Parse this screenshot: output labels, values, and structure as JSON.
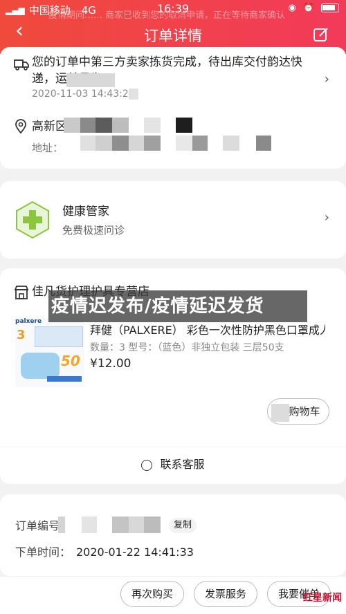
{
  "status_bar": {
    "carrier": "中国移动",
    "network": "4G",
    "time": "16:39"
  },
  "header": {
    "title": "订单详情",
    "notice": "疫情期间…… 商家已收到您的取消申请，正在等待商家确认"
  },
  "shipping": {
    "message": "您的订单中第三方卖家拣货完成，待出库交付韵达快递，运单号为",
    "timestamp": "2020-11-03 14:43:29",
    "address_name": "高新区",
    "address_label": "地址："
  },
  "health": {
    "title": "健康管家",
    "subtitle": "免费极速问诊"
  },
  "store": {
    "name": "佳凡货护理护具专营店",
    "product": {
      "brand_tag": "palxere",
      "name": "拜健（PALXERE） 彩色一次性防护黑色口罩成人...",
      "spec": "数量：3  型号：（蓝色）非独立包装 三层50支",
      "price": "¥12.00",
      "image_badge": "50",
      "image_count": "3"
    },
    "cart_button": "购物车",
    "service_button": "联系客服"
  },
  "overlay_caption": "疫情迟发布/疫情延迟发货",
  "order": {
    "number_label": "订单编号：",
    "copy_button": "复制",
    "time_label": "下单时间：",
    "time_value": "2020-01-22 14:41:33"
  },
  "actions": {
    "rebuy": "再次购买",
    "invoice": "发票服务",
    "urge": "我要催单"
  },
  "watermark": "红星新闻",
  "colors": {
    "header_start": "#f04a3c",
    "header_end": "#f23a5a",
    "health_green": "#8cc63f"
  }
}
